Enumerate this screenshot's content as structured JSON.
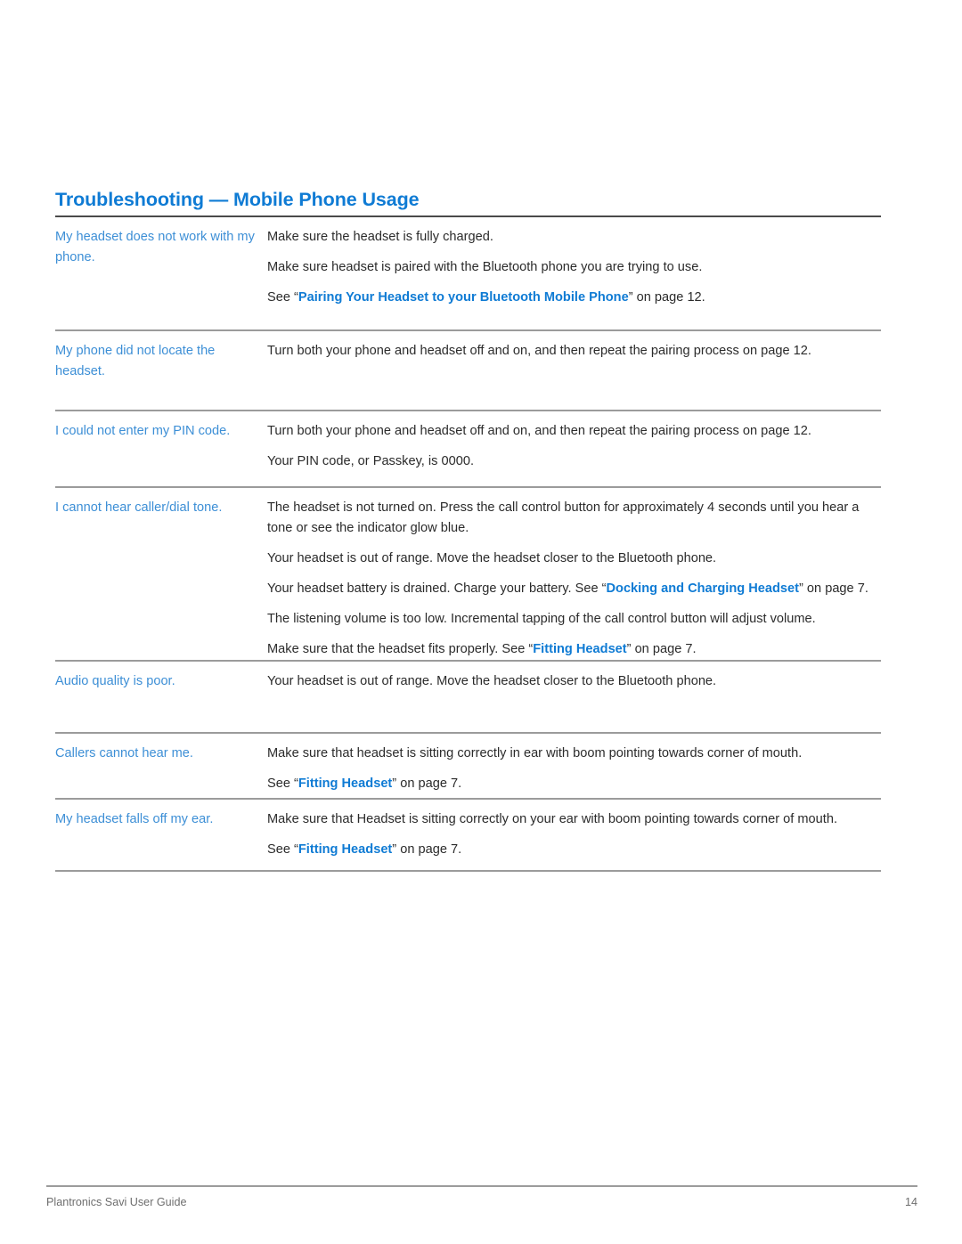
{
  "document": {
    "heading": "Troubleshooting — Mobile Phone Usage",
    "accent_color": "#0f7bd4",
    "label_color": "#3d8fd6",
    "body_color": "#2b2b2b",
    "rule_color": "#9b9b9b",
    "heading_rule_color": "#4a4a4a"
  },
  "table": {
    "rows": [
      {
        "question": "My headset does not work with my phone.",
        "answers": [
          {
            "pre": "Make sure the headset is fully charged.",
            "link": "",
            "post": ""
          },
          {
            "pre": "Make sure headset is paired with the Bluetooth phone you are trying to use.",
            "link": "",
            "post": ""
          },
          {
            "pre": "See “",
            "link": "Pairing Your Headset to your Bluetooth Mobile Phone",
            "post": "” on page 12."
          }
        ]
      },
      {
        "question": "My phone did not locate the headset.",
        "answers": [
          {
            "pre": "Turn both your phone and headset off and on, and then repeat the pairing process on page 12.",
            "link": "",
            "post": ""
          }
        ]
      },
      {
        "question": "I could not enter my PIN code.",
        "answers": [
          {
            "pre": "Turn both your phone and headset off and on, and then repeat the pairing process on page 12.",
            "link": "",
            "post": ""
          },
          {
            "pre": "Your PIN code, or Passkey, is 0000.",
            "link": "",
            "post": ""
          }
        ]
      },
      {
        "question": "I cannot hear caller/dial tone.",
        "answers": [
          {
            "pre": "The headset is not turned on. Press the call control button for approximately 4 seconds until you hear a tone or see the indicator glow blue.",
            "link": "",
            "post": ""
          },
          {
            "pre": "Your headset is out of range. Move the headset closer to the Bluetooth phone.",
            "link": "",
            "post": ""
          },
          {
            "pre": "Your headset battery is drained. Charge your battery. See “",
            "link": "Docking and Charging Headset",
            "post": "” on page 7."
          },
          {
            "pre": "The listening volume is too low. Incremental tapping of the call control button will adjust volume.",
            "link": "",
            "post": ""
          },
          {
            "pre": "Make sure that the headset fits properly. See “",
            "link": "Fitting Headset",
            "post": "” on page 7."
          }
        ]
      },
      {
        "question": "Audio quality is poor.",
        "answers": [
          {
            "pre": "Your headset is out of range. Move the headset closer to the Bluetooth phone.",
            "link": "",
            "post": ""
          }
        ]
      },
      {
        "question": "Callers cannot hear me.",
        "answers": [
          {
            "pre": "Make sure that headset is sitting correctly in ear with boom pointing towards corner of mouth.",
            "link": "",
            "post": ""
          },
          {
            "pre": "See “",
            "link": "Fitting Headset",
            "post": "” on page 7."
          }
        ]
      },
      {
        "question": "My headset falls off my ear.",
        "answers": [
          {
            "pre": "Make sure that Headset is sitting correctly on your ear with boom pointing towards corner of mouth.",
            "link": "",
            "post": ""
          },
          {
            "pre": "See “",
            "link": "Fitting Headset",
            "post": "” on page 7."
          }
        ]
      }
    ]
  },
  "footer": {
    "left": "Plantronics Savi User Guide",
    "page_number": "14"
  }
}
